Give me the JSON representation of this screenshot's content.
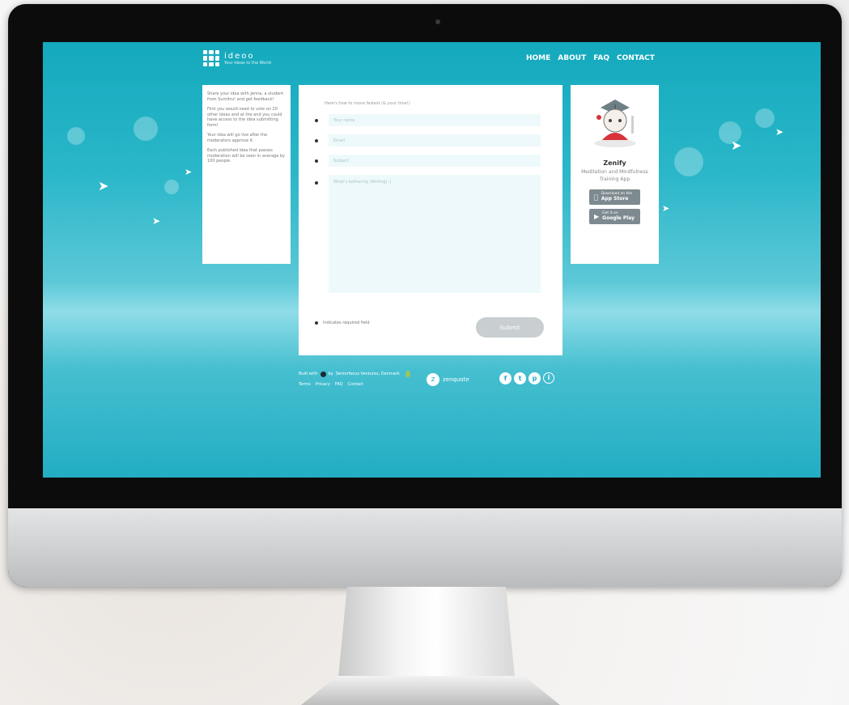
{
  "header": {
    "logo_name": "ideoo",
    "logo_tagline": "Your Ideas to the World",
    "nav": [
      "HOME",
      "ABOUT",
      "FAQ",
      "CONTACT"
    ]
  },
  "left_card": {
    "paragraphs": [
      "Share your idea with Jenna, a student from Sumitru! and get feedback!",
      "First you would need to vote on 20 other ideas and at the end you could have access to the idea submitting form!",
      "Your idea will go live after the moderators approve it.",
      "Each published idea that passes moderation will be seen in average by 100 people."
    ]
  },
  "form": {
    "intro": "Here's how to move fastest (& your time!)",
    "name_placeholder": "Your name",
    "email_placeholder": "Email",
    "subject_placeholder": "Subject",
    "message_placeholder": "What's bothering (Writing) :)",
    "required_note": "Indicates required field",
    "submit_label": "Submit"
  },
  "app_card": {
    "name": "Zenify",
    "description": "Meditation and Mindfulness Training App",
    "app_store_small": "Download on the",
    "app_store_big": "App Store",
    "google_play_small": "Get it on",
    "google_play_big": "Google Play"
  },
  "footer": {
    "built_with": "Built with",
    "by": "by",
    "company": "Seniorfocus Ventures, Denmark",
    "links": [
      "Terms",
      "Privacy",
      "FAQ",
      "Contact"
    ],
    "partner": "zenquote",
    "socials": [
      "f",
      "t",
      "p",
      "i"
    ]
  }
}
